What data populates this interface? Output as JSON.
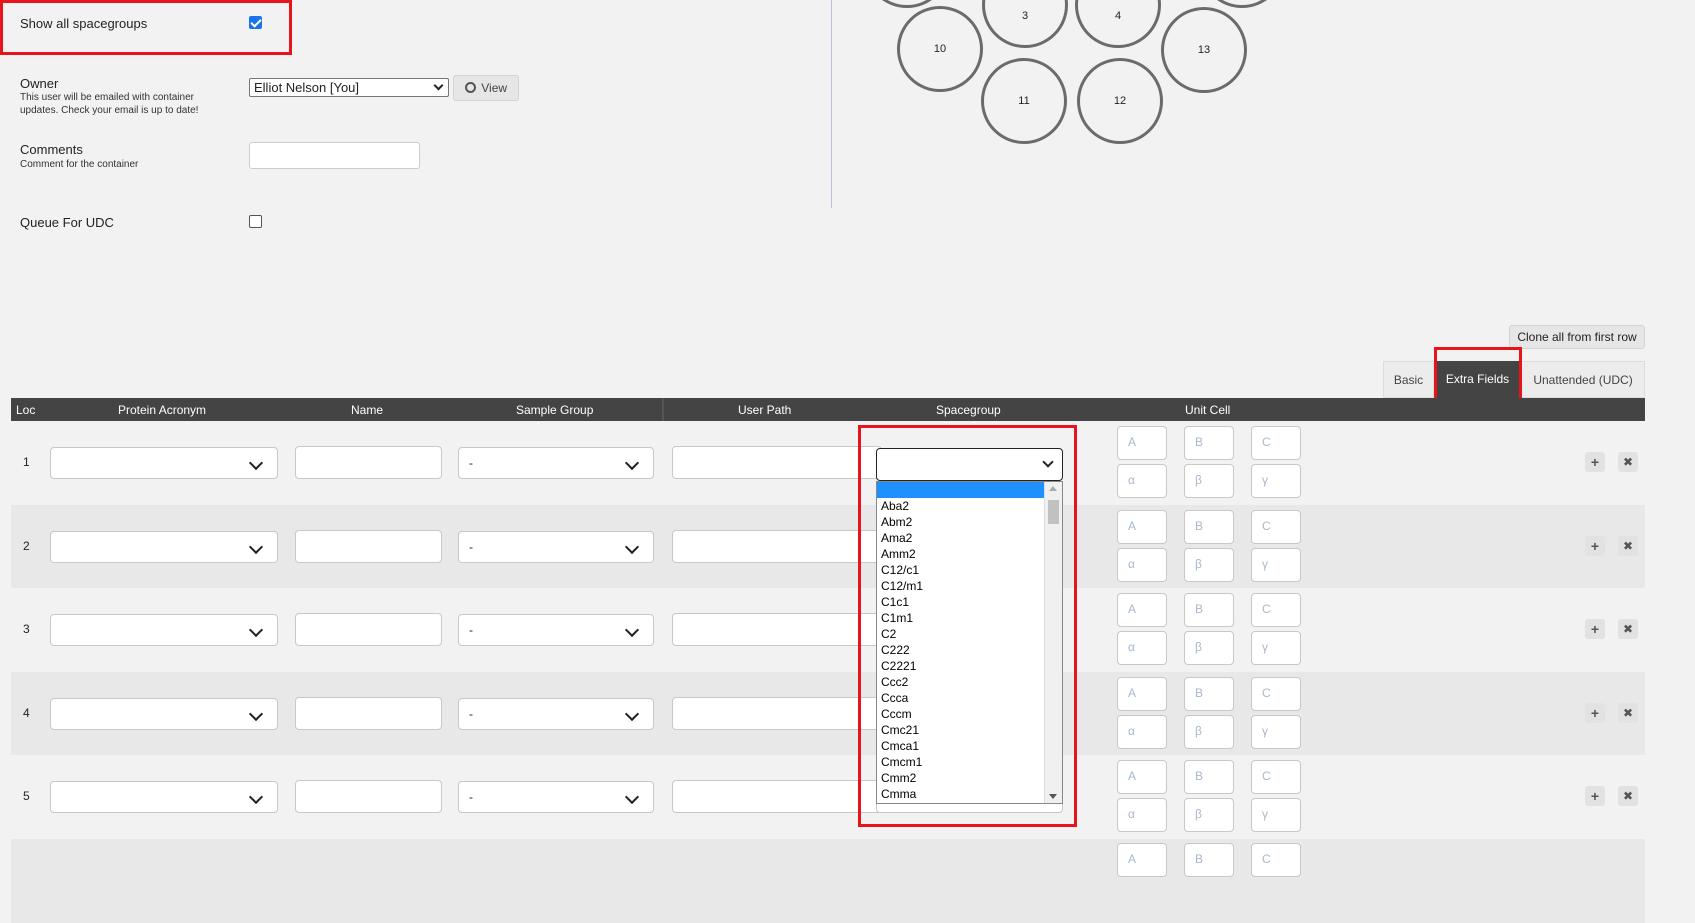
{
  "form": {
    "show_all_spacegroups_label": "Show all spacegroups",
    "show_all_spacegroups_checked": true,
    "owner_label": "Owner",
    "owner_help": "This user will be emailed with container updates. Check your email is up to date!",
    "owner_value": "Elliot Nelson [You]",
    "view_button_label": "View",
    "comments_label": "Comments",
    "comments_help": "Comment for the container",
    "comments_value": "",
    "queue_udc_label": "Queue For UDC",
    "queue_udc_checked": false
  },
  "puck": {
    "positions": [
      "3",
      "4",
      "10",
      "11",
      "12",
      "13"
    ]
  },
  "controls": {
    "clone_button_label": "Clone all from first row",
    "tabs": [
      "Basic",
      "Extra Fields",
      "Unattended (UDC)"
    ],
    "active_tab": "Extra Fields"
  },
  "table": {
    "headers": [
      "Loc",
      "Protein Acronym",
      "Name",
      "Sample Group",
      "User Path",
      "Spacegroup",
      "Unit Cell"
    ],
    "rows": [
      {
        "loc": "1",
        "sample_group": "-"
      },
      {
        "loc": "2",
        "sample_group": "-"
      },
      {
        "loc": "3",
        "sample_group": "-"
      },
      {
        "loc": "4",
        "sample_group": "-"
      },
      {
        "loc": "5",
        "sample_group": "-"
      }
    ],
    "unit_cell_placeholders": [
      "A",
      "B",
      "C",
      "α",
      "β",
      "γ"
    ],
    "add_icon": "plus-icon",
    "remove_icon": "close-icon"
  },
  "spacegroup_dropdown": {
    "selected": "",
    "options": [
      "",
      "Aba2",
      "Abm2",
      "Ama2",
      "Amm2",
      "C12/c1",
      "C12/m1",
      "C1c1",
      "C1m1",
      "C2",
      "C222",
      "C2221",
      "Ccc2",
      "Ccca",
      "Cccm",
      "Cmc21",
      "Cmca1",
      "Cmcm1",
      "Cmm2",
      "Cmma"
    ]
  },
  "colors": {
    "highlight": "#e8141b",
    "header_bg": "#444444",
    "active_tab_bg": "#444444",
    "selected_option": "#1e90ff"
  }
}
